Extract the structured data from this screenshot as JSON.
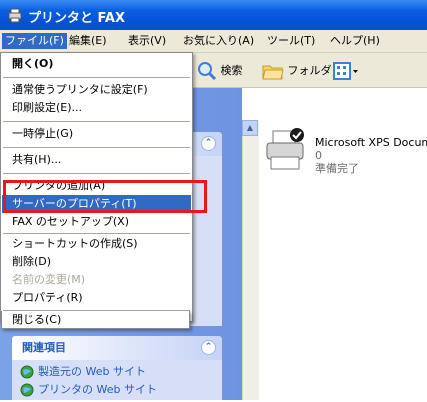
{
  "window": {
    "title": "プリンタと FAX"
  },
  "menubar": {
    "items": [
      {
        "label": "ファイル(F)",
        "active": true
      },
      {
        "label": "編集(E)"
      },
      {
        "label": "表示(V)"
      },
      {
        "label": "お気に入り(A)"
      },
      {
        "label": "ツール(T)"
      },
      {
        "label": "ヘルプ(H)"
      }
    ]
  },
  "toolbar": {
    "search_label": "検索",
    "folders_label": "フォルダ"
  },
  "file_menu": {
    "items": [
      {
        "label": "開く(O)",
        "bold": true
      },
      {
        "label": "通常使うプリンタに設定(F)"
      },
      {
        "label": "印刷設定(E)..."
      },
      {
        "label": "一時停止(G)"
      },
      {
        "label": "共有(H)..."
      },
      {
        "label": "プリンタの追加(A)"
      },
      {
        "label": "サーバーのプロパティ(T)",
        "selected": true
      },
      {
        "label": "FAX のセットアップ(X)"
      },
      {
        "label": "ショートカットの作成(S)"
      },
      {
        "label": "削除(D)"
      },
      {
        "label": "名前の変更(M)",
        "disabled": true
      },
      {
        "label": "プロパティ(R)"
      },
      {
        "label": "閉じる(C)"
      }
    ]
  },
  "related": {
    "header": "関連項目",
    "links": [
      "製造元の Web サイト",
      "プリンタの Web サイト"
    ]
  },
  "printer": {
    "name": "Microsoft XPS Docum",
    "jobs": "0",
    "status": "準備完了"
  },
  "colors": {
    "title_bar": "#0552d6",
    "menu_highlight": "#316ac5",
    "callout_red": "#e8171b",
    "task_pane": "#7ba2e7"
  }
}
